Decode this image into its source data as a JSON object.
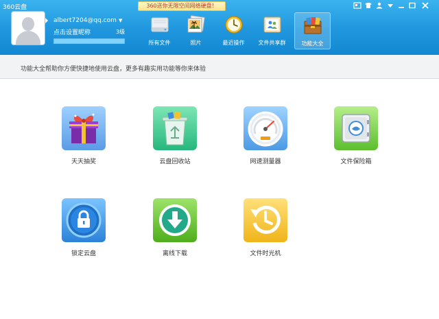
{
  "app": {
    "title": "360云盘"
  },
  "promo": {
    "text": "360送你无限空间网络硬盘！"
  },
  "window_controls": [
    "skin-icon",
    "feedback-icon",
    "menu-icon",
    "minimize-icon",
    "maximize-icon",
    "close-icon"
  ],
  "user": {
    "email": "albert7204@qq.com",
    "subtitle": "点击设置昵称",
    "level": "3级",
    "quota_fraction": 1.0
  },
  "nav": [
    {
      "label": "所有文件",
      "icon": "drive-icon"
    },
    {
      "label": "照片",
      "icon": "photo-icon"
    },
    {
      "label": "最近操作",
      "icon": "clock-icon"
    },
    {
      "label": "文件共享群",
      "icon": "share-group-icon"
    },
    {
      "label": "功能大全",
      "icon": "toolbox-icon",
      "active": true
    }
  ],
  "info": {
    "text": "功能大全帮助你方便快捷地使用云盘，更多有趣实用功能等你来体验"
  },
  "features": [
    {
      "label": "天天抽奖",
      "icon": "gift-icon"
    },
    {
      "label": "云盘回收站",
      "icon": "recycle-bin-icon"
    },
    {
      "label": "网速测量器",
      "icon": "speedometer-icon"
    },
    {
      "label": "文件保险箱",
      "icon": "safe-icon"
    },
    {
      "label": "锁定云盘",
      "icon": "lock-icon"
    },
    {
      "label": "离线下载",
      "icon": "download-icon"
    },
    {
      "label": "文件时光机",
      "icon": "time-machine-icon"
    }
  ],
  "colors": {
    "header": "#1f96dd",
    "accent": "#3ab3ef",
    "infobar": "#f1f3f4"
  }
}
